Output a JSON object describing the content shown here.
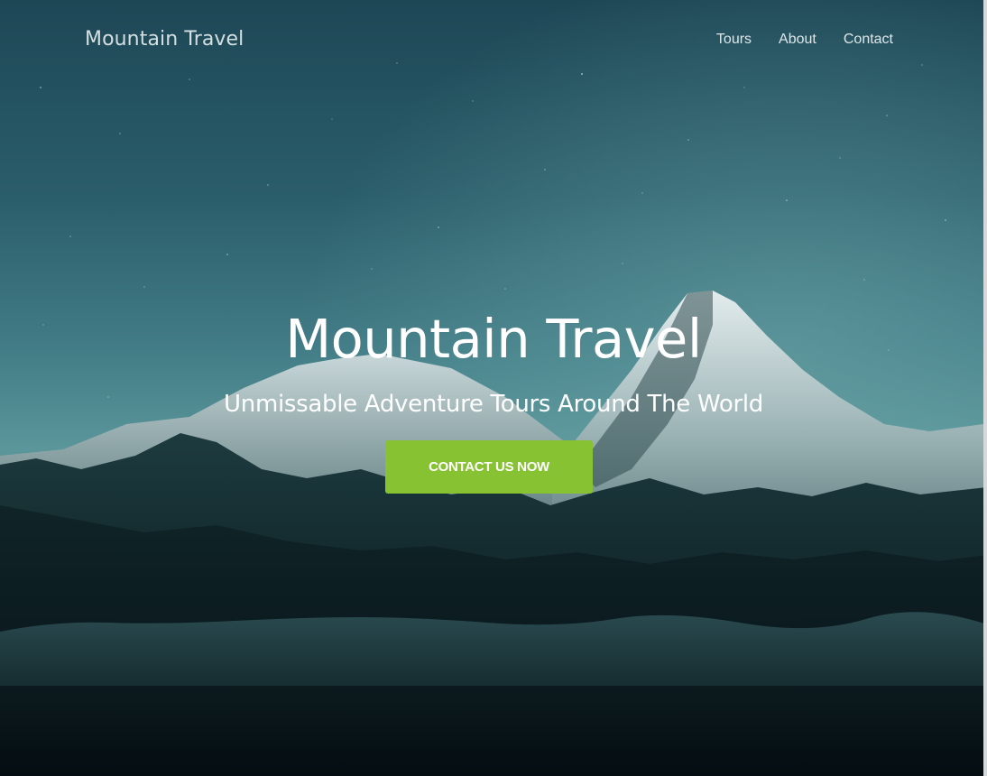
{
  "nav": {
    "logo": "Mountain Travel",
    "links": [
      "Tours",
      "About",
      "Contact"
    ]
  },
  "hero": {
    "title": "Mountain Travel",
    "subtitle": "Unmissable Adventure Tours Around The World",
    "cta_label": "CONTACT US NOW"
  },
  "colors": {
    "accent": "#86c232",
    "sky_top": "#1f4a5a",
    "sky_mid": "#4f8a93",
    "mountains": "#0f2428"
  },
  "background_image": "night-mountain-landscape"
}
